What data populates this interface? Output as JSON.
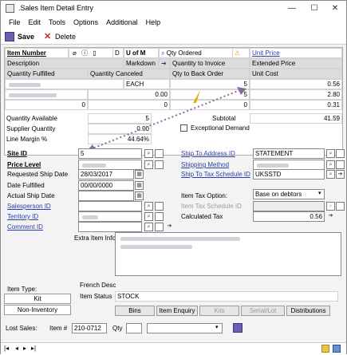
{
  "window": {
    "title": ".Sales Item Detail Entry",
    "minimize": "—",
    "maximize": "☐",
    "close": "✕"
  },
  "menu": [
    "File",
    "Edit",
    "Tools",
    "Options",
    "Additional",
    "Help"
  ],
  "toolbar": {
    "save": "Save",
    "delete": "Delete"
  },
  "grid": {
    "headers": {
      "item_number": "Item Number",
      "d": "D",
      "u_of_m": "U of M",
      "qty_ordered": "Qty Ordered",
      "unit_price": "Unit Price",
      "description": "Description",
      "markdown": "Markdown",
      "qty_to_invoice": "Quantity to Invoice",
      "extended_price": "Extended Price",
      "qty_fulfilled": "Quantity Fulfilled",
      "qty_canceled": "Quantity Canceled",
      "qty_to_back_order": "Qty to Back Order",
      "unit_cost": "Unit Cost"
    },
    "row": {
      "u_of_m": "EACH",
      "qty_ordered": "5",
      "unit_price": "0.56",
      "markdown": "0.00",
      "qty_to_invoice": "5",
      "extended_price": "2.80",
      "qty_fulfilled": "0",
      "qty_canceled": "0",
      "qty_to_back_order": "0",
      "unit_cost": "0.31"
    },
    "summary": {
      "qty_available_label": "Quantity Available",
      "qty_available": "5",
      "supplier_qty_label": "Supplier Quantity",
      "supplier_qty": "0.00",
      "line_margin_label": "Line Margin %",
      "line_margin": "44.64%",
      "subtotal_label": "Subtotal",
      "subtotal": "41.59",
      "exceptional_demand": "Exceptional Demand"
    }
  },
  "form": {
    "site_id_label": "Site ID",
    "site_id": "5",
    "price_level_label": "Price Level",
    "requested_ship_label": "Requested Ship Date",
    "requested_ship": "28/03/2017",
    "date_fulfilled_label": "Date Fulfilled",
    "date_fulfilled": "00/00/0000",
    "actual_ship_label": "Actual Ship Date",
    "salesperson_label": "Salesperson ID",
    "territory_label": "Territory ID",
    "comment_label": "Comment ID",
    "ship_to_address_label": "Ship To Address ID",
    "ship_to_address": "STATEMENT",
    "shipping_method_label": "Shipping Method",
    "ship_to_tax_label": "Ship To Tax Schedule ID",
    "ship_to_tax": "UKSSTD",
    "item_tax_option_label": "Item Tax Option:",
    "item_tax_option": "Base on debtors",
    "item_tax_schedule_label": "Item Tax Schedule ID",
    "calculated_tax_label": "Calculated Tax",
    "calculated_tax": "0.56",
    "extra_info_label": "Extra Item Info"
  },
  "bottom": {
    "item_type_label": "Item Type:",
    "kit": "Kit",
    "non_inventory": "Non-Inventory",
    "french_desc_label": "French Desc",
    "item_status_label": "Item Status",
    "item_status": "STOCK",
    "bins": "Bins",
    "item_enquiry": "Item Enquiry",
    "kits": "Kits",
    "serial_lot": "Serial/Lot",
    "distributions": "Distributions",
    "lost_sales_label": "Lost Sales:",
    "item_hash_label": "Item #",
    "item_hash": "210-0712",
    "qty_label": "Qty"
  },
  "icons": [
    "app-icon",
    "save-icon",
    "delete-icon",
    "lookup-icon",
    "note-icon",
    "calendar-icon",
    "arrow-icon",
    "warning-icon",
    "nav-first-icon",
    "nav-prev-icon",
    "nav-next-icon",
    "nav-last-icon"
  ]
}
